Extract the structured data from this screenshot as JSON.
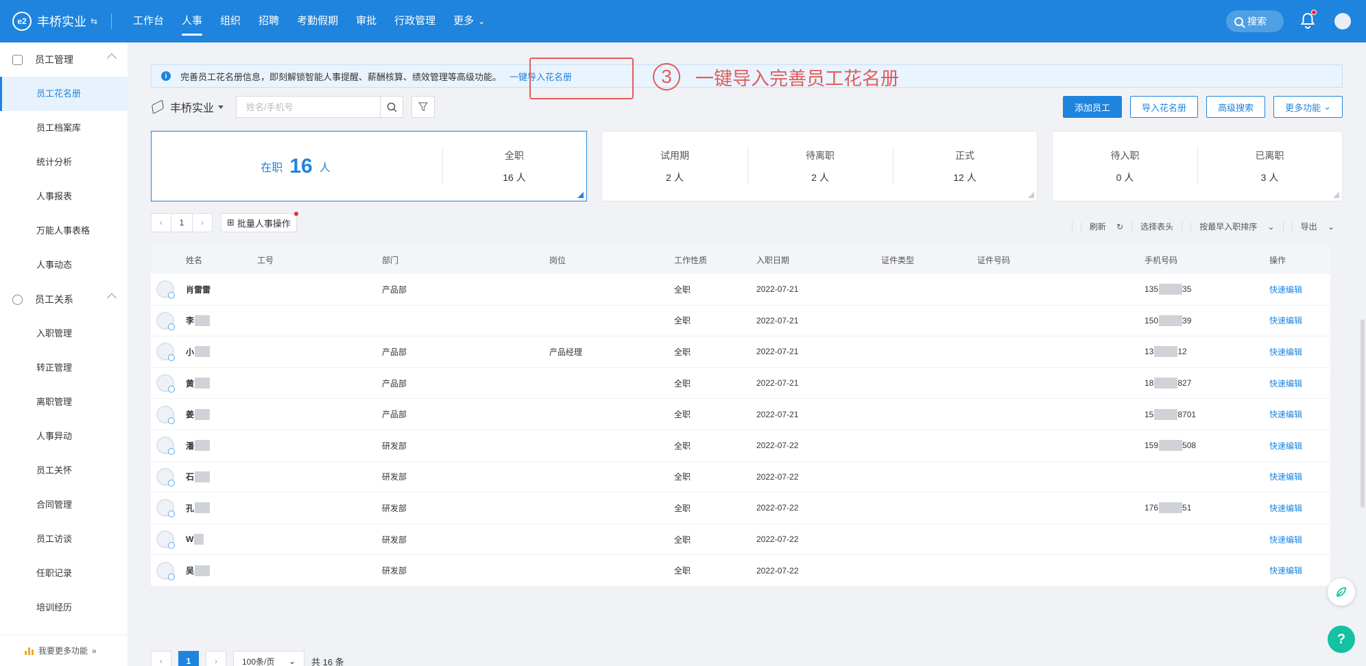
{
  "brand": {
    "name": "丰桥实业",
    "switch_icon": "⇆"
  },
  "nav": {
    "items": [
      "工作台",
      "人事",
      "组织",
      "招聘",
      "考勤假期",
      "审批",
      "行政管理",
      "更多"
    ],
    "active_index": 1,
    "search_label": "搜索"
  },
  "sidebar": {
    "group1": "员工管理",
    "group1_items": [
      "员工花名册",
      "员工档案库",
      "统计分析",
      "人事报表",
      "万能人事表格",
      "人事动态"
    ],
    "group2": "员工关系",
    "group2_items": [
      "入职管理",
      "转正管理",
      "离职管理",
      "人事异动",
      "员工关怀",
      "合同管理",
      "员工访谈",
      "任职记录",
      "培训经历"
    ],
    "bottom": "我要更多功能"
  },
  "notice": {
    "text": "完善员工花名册信息，即刻解锁智能人事提醒、薪酬核算、绩效管理等高级功能。",
    "link": "一键导入花名册"
  },
  "annotation": {
    "number": "3",
    "text": "一键导入完善员工花名册"
  },
  "toolbar": {
    "org": "丰桥实业",
    "search_placeholder": "姓名/手机号",
    "buttons": {
      "add": "添加员工",
      "import": "导入花名册",
      "advanced": "高级搜索",
      "more": "更多功能"
    }
  },
  "stats": {
    "on_job_label": "在职",
    "on_job_count": "16",
    "on_job_unit": "人",
    "fulltime_label": "全职",
    "fulltime_value": "16 人",
    "probation_label": "试用期",
    "probation_value": "2 人",
    "pending_leave_label": "待离职",
    "pending_leave_value": "2 人",
    "formal_label": "正式",
    "formal_value": "12 人",
    "pending_join_label": "待入职",
    "pending_join_value": "0 人",
    "left_label": "已离职",
    "left_value": "3 人"
  },
  "pager_top": {
    "page": "1",
    "batch": "批量人事操作"
  },
  "table_tools": [
    "刷新",
    "选择表头",
    "按最早入职排序",
    "导出"
  ],
  "table": {
    "headers": [
      "姓名",
      "工号",
      "部门",
      "岗位",
      "工作性质",
      "入职日期",
      "证件类型",
      "证件号码",
      "手机号码",
      "操作"
    ],
    "rows": [
      {
        "name": "肖雷雷",
        "dept": "产品部",
        "post": "",
        "type": "全职",
        "date": "2022-07-21",
        "phone_a": "135",
        "phone_b": "35",
        "op": "快速编辑"
      },
      {
        "name": "李",
        "dept": "",
        "post": "",
        "type": "全职",
        "date": "2022-07-21",
        "phone_a": "150",
        "phone_b": "39",
        "op": "快速编辑"
      },
      {
        "name": "小",
        "dept": "产品部",
        "post": "产品经理",
        "type": "全职",
        "date": "2022-07-21",
        "phone_a": "13",
        "phone_b": "12",
        "op": "快速编辑"
      },
      {
        "name": "黄",
        "dept": "产品部",
        "post": "",
        "type": "全职",
        "date": "2022-07-21",
        "phone_a": "18",
        "phone_b": "827",
        "op": "快速编辑"
      },
      {
        "name": "姜",
        "dept": "产品部",
        "post": "",
        "type": "全职",
        "date": "2022-07-21",
        "phone_a": "15",
        "phone_b": "8701",
        "op": "快速编辑"
      },
      {
        "name": "潘",
        "dept": "研发部",
        "post": "",
        "type": "全职",
        "date": "2022-07-22",
        "phone_a": "159",
        "phone_b": "508",
        "op": "快速编辑"
      },
      {
        "name": "石",
        "dept": "研发部",
        "post": "",
        "type": "全职",
        "date": "2022-07-22",
        "phone_a": "",
        "phone_b": "",
        "op": "快速编辑"
      },
      {
        "name": "孔",
        "dept": "研发部",
        "post": "",
        "type": "全职",
        "date": "2022-07-22",
        "phone_a": "176",
        "phone_b": "51",
        "op": "快速编辑"
      },
      {
        "name": "W",
        "dept": "研发部",
        "post": "",
        "type": "全职",
        "date": "2022-07-22",
        "phone_a": "",
        "phone_b": "",
        "op": "快速编辑"
      },
      {
        "name": "吴",
        "dept": "研发部",
        "post": "",
        "type": "全职",
        "date": "2022-07-22",
        "phone_a": "",
        "phone_b": "",
        "op": "快速编辑"
      }
    ]
  },
  "pager_bottom": {
    "page": "1",
    "per_page": "100条/页",
    "total": "共 16 条"
  },
  "colors": {
    "primary": "#1e84dd",
    "annotation": "#e35b5b",
    "danger": "#f5222d"
  }
}
